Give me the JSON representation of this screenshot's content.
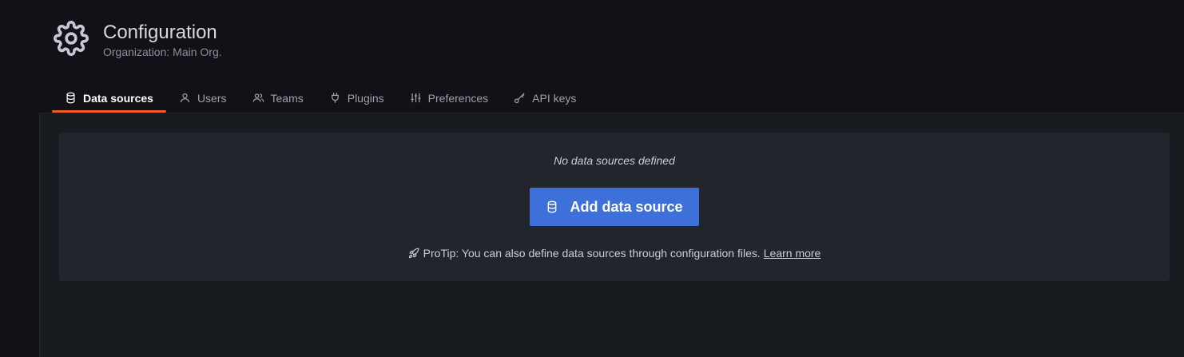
{
  "header": {
    "title": "Configuration",
    "subtitle": "Organization: Main Org.",
    "icon": "gear-icon"
  },
  "tabs": [
    {
      "label": "Data sources",
      "icon": "database-icon",
      "active": true
    },
    {
      "label": "Users",
      "icon": "user-icon",
      "active": false
    },
    {
      "label": "Teams",
      "icon": "users-icon",
      "active": false
    },
    {
      "label": "Plugins",
      "icon": "plug-icon",
      "active": false
    },
    {
      "label": "Preferences",
      "icon": "sliders-icon",
      "active": false
    },
    {
      "label": "API keys",
      "icon": "key-icon",
      "active": false
    }
  ],
  "empty_state": {
    "title": "No data sources defined",
    "button_label": "Add data source",
    "protip_text": "ProTip: You can also define data sources through configuration files.",
    "learn_more": "Learn more"
  },
  "colors": {
    "background": "#111217",
    "panel": "#181b1f",
    "card": "#22252b",
    "primary_button": "#3d71d9",
    "active_tab_underline": "#f05a28"
  }
}
